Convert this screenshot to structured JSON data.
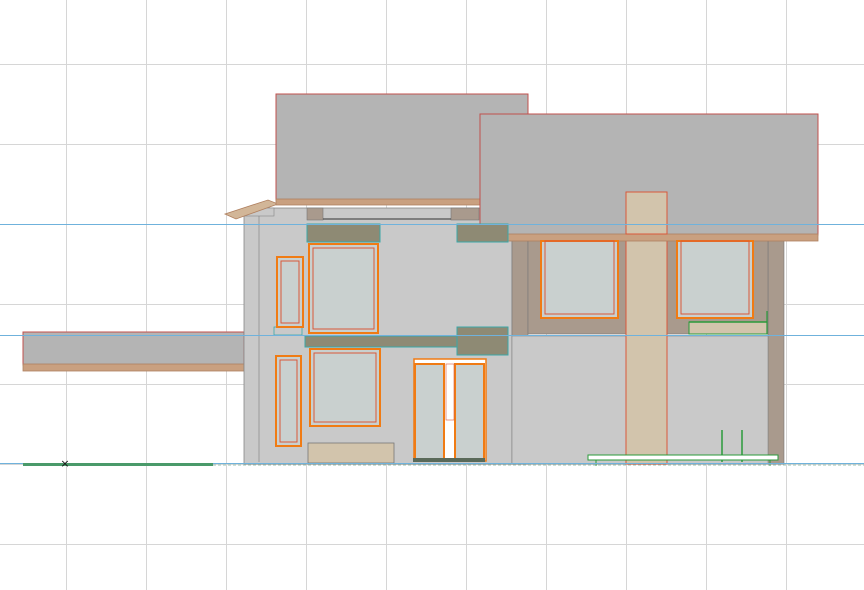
{
  "view": {
    "type": "elevation-drawing",
    "grid": true,
    "ground_marker_symbol": "×"
  },
  "colors": {
    "background": "#ffffff",
    "grid": "#d6d6d6",
    "story_line": "#6fb2dc",
    "roof": "#b4b4b4",
    "roof_edge": "#c9a080",
    "wall_front": "#c9c9c9",
    "wall_back": "#a99a8d",
    "wall_dark": "#8e8878",
    "column": "#d2c4ac",
    "window_glass": "#c9d0cf",
    "window_frame": "#f07b14",
    "frame_red": "#d9573a",
    "lintel": "#8e8a74",
    "lintel_edge": "#3aa8a8",
    "railing": "#2a9a3a",
    "ground_line": "#4a9a6a"
  }
}
